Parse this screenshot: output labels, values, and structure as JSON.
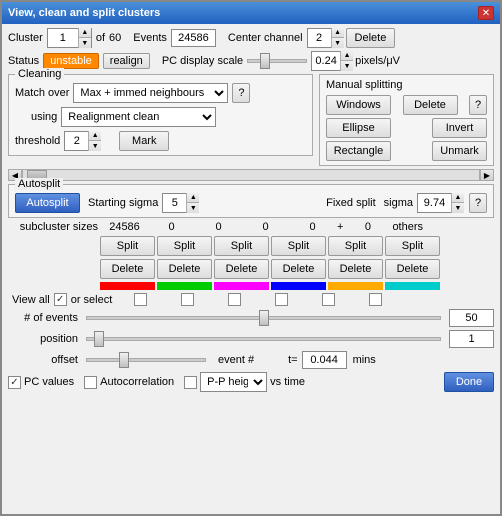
{
  "window": {
    "title": "View, clean and split clusters",
    "close_label": "✕"
  },
  "cluster": {
    "label": "Cluster",
    "value": "1",
    "of_label": "of",
    "total": "60",
    "events_label": "Events",
    "events_value": "24586",
    "center_label": "Center channel",
    "center_value": "2",
    "delete_label": "Delete"
  },
  "status": {
    "label": "Status",
    "unstable_label": "unstable",
    "realign_label": "realign",
    "pc_display_label": "PC display scale",
    "pc_display_value": "0.24",
    "pixels_label": "pixels/μV"
  },
  "cleaning": {
    "title": "Cleaning",
    "match_label": "Match over",
    "match_value": "Max + immed neighbours",
    "help_label": "?",
    "using_label": "using",
    "using_value": "Realignment clean",
    "threshold_label": "threshold",
    "threshold_value": "2",
    "mark_label": "Mark"
  },
  "manual_splitting": {
    "title": "Manual splitting",
    "windows_label": "Windows",
    "delete_label": "Delete",
    "help_label": "?",
    "ellipse_label": "Ellipse",
    "invert_label": "Invert",
    "rectangle_label": "Rectangle",
    "unmark_label": "Unmark"
  },
  "autosplit": {
    "title": "Autosplit",
    "autosplit_label": "Autosplit",
    "starting_sigma_label": "Starting sigma",
    "starting_sigma_value": "5",
    "fixed_split_label": "Fixed split",
    "sigma_label": "sigma",
    "sigma_value": "9.74",
    "help_label": "?"
  },
  "subcluster": {
    "sizes_label": "subcluster sizes",
    "values": [
      "24586",
      "0",
      "0",
      "0",
      "0",
      "+",
      "0"
    ],
    "others_label": "others",
    "split_labels": [
      "Split",
      "Split",
      "Split",
      "Split",
      "Split",
      "Split"
    ],
    "delete_labels": [
      "Delete",
      "Delete",
      "Delete",
      "Delete",
      "Delete",
      "Delete"
    ],
    "colors": [
      "#ff0000",
      "#00cc00",
      "#ff00ff",
      "#0000ff",
      "#ffaa00",
      "#00cccc"
    ]
  },
  "view_all": {
    "label": "View all",
    "or_select_label": "or select"
  },
  "sliders": {
    "events_label": "# of events",
    "events_value": "50",
    "position_label": "position",
    "position_value": "1",
    "offset_label": "offset",
    "event_num_label": "event #",
    "t_label": "t=",
    "t_value": "0.044",
    "mins_label": "mins"
  },
  "bottom": {
    "pc_values_label": "PC values",
    "autocorrelation_label": "Autocorrelation",
    "pp_height_label": "P-P height",
    "vs_time_label": "vs time",
    "done_label": "Done",
    "height_label": "height"
  }
}
